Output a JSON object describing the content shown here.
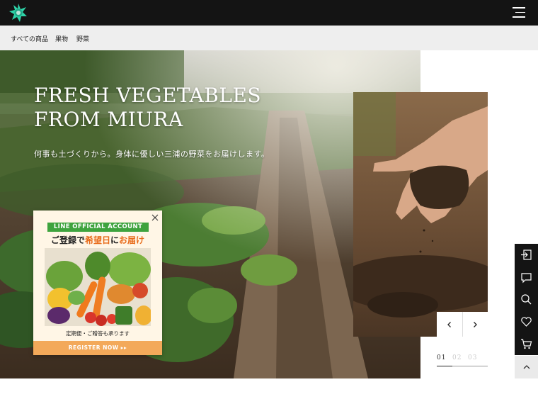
{
  "header": {
    "logo_icon": "brand-flower-logo-icon",
    "menu_icon": "hamburger-menu-icon"
  },
  "categories": [
    "すべての商品",
    "果物",
    "野菜"
  ],
  "hero": {
    "title": "FRESH VEGETABLES FROM MIURA",
    "subtitle": "何事も土づくりから。身体に優しい三浦の野菜をお届けします。",
    "prev_icon": "chevron-left-icon",
    "next_icon": "chevron-right-icon",
    "slides": [
      "01",
      "02",
      "03"
    ],
    "active_slide": 1,
    "slide_count": 3
  },
  "popup": {
    "badge": "LINE OFFICIAL ACCOUNT",
    "heading_pre": "ご登録で",
    "heading_hl1": "希望日",
    "heading_mid": "に",
    "heading_hl2": "お届け",
    "note": "定期便・ご贈答も承ります",
    "register": "REGISTER NOW ▸▸",
    "close_icon": "close-icon"
  },
  "siderail": {
    "icons": [
      "login-icon",
      "chat-icon",
      "search-icon",
      "heart-icon",
      "cart-icon"
    ],
    "top_icon": "chevron-up-icon"
  },
  "colors": {
    "topbar": "#141414",
    "catbar": "#eeeeee",
    "line_green": "#3ea33e",
    "accent_orange": "#e86b1a",
    "register_orange": "#f3a95a"
  }
}
